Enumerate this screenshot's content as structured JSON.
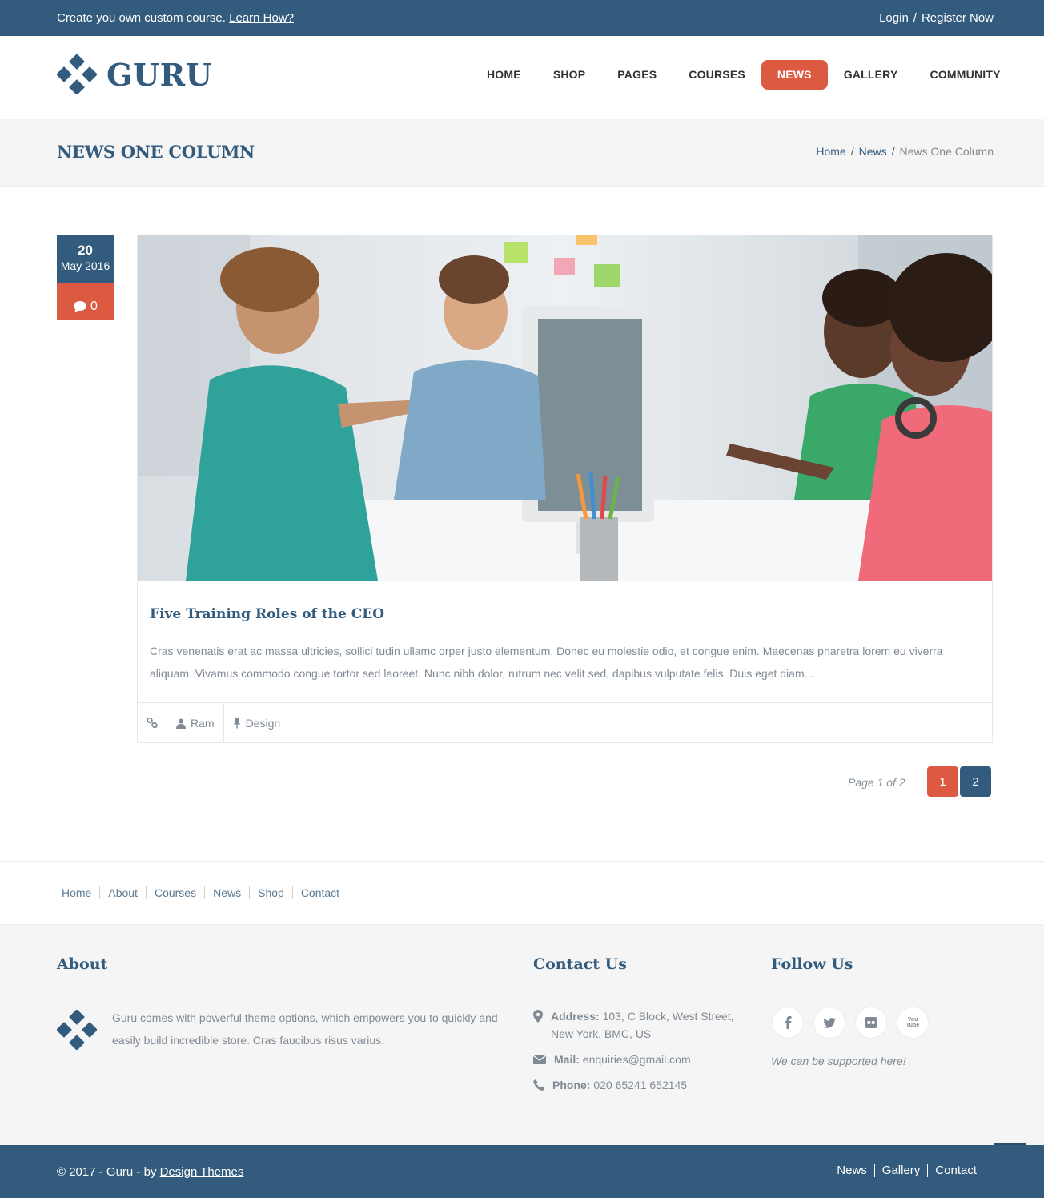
{
  "topbar": {
    "promo_text": "Create you own custom course.",
    "promo_link": "Learn How?",
    "login": "Login",
    "separator": "/",
    "register": "Register Now"
  },
  "header": {
    "logo_text": "GURU",
    "nav": [
      "HOME",
      "SHOP",
      "PAGES",
      "COURSES",
      "NEWS",
      "GALLERY",
      "COMMUNITY"
    ],
    "active_nav": "NEWS"
  },
  "title_band": {
    "title": "NEWS ONE COLUMN",
    "breadcrumb": [
      "Home",
      "News",
      "News One Column"
    ],
    "separator": "/"
  },
  "post": {
    "day": "20",
    "month_year": "May 2016",
    "comment_count": "0",
    "image_icon": "photo-people-at-computer",
    "title": "Five Training Roles of the CEO",
    "excerpt": "Cras venenatis erat ac massa ultricies, sollici tudin ullamc orper justo elementum. Donec eu molestie odio, et congue enim. Maecenas pharetra lorem eu viverra aliquam. Vivamus commodo congue tortor sed laoreet. Nunc nibh dolor, rutrum nec velit sed, dapibus vulputate felis. Duis eget diam...",
    "author": "Ram",
    "category": "Design"
  },
  "pagination": {
    "info": "Page 1 of 2",
    "pages": [
      "1",
      "2"
    ],
    "current": "1"
  },
  "footer_nav": [
    "Home",
    "About",
    "Courses",
    "News",
    "Shop",
    "Contact"
  ],
  "footer": {
    "about_title": "About",
    "about_text": "Guru comes with powerful theme options, which empowers you to quickly and easily build incredible store. Cras faucibus risus varius.",
    "contact_title": "Contact Us",
    "address_label": "Address:",
    "address_line1": "103, C Block, West Street,",
    "address_line2": "New York, BMC, US",
    "mail_label": "Mail:",
    "mail": "enquiries@gmail.com",
    "phone_label": "Phone:",
    "phone": "020 65241 652145",
    "follow_title": "Follow Us",
    "social_icons": [
      "facebook-icon",
      "twitter-icon",
      "flickr-icon",
      "youtube-icon"
    ],
    "youtube_text": "You Tube",
    "support_text": "We can be supported here!"
  },
  "bottom": {
    "copyright": "© 2017 - Guru - by",
    "credit_link": "Design Themes",
    "links": [
      "News",
      "Gallery",
      "Contact"
    ]
  },
  "colors": {
    "primary": "#325b7d",
    "accent": "#dc5a42",
    "muted_text": "#808a94",
    "light_bg": "#f5f5f5"
  }
}
